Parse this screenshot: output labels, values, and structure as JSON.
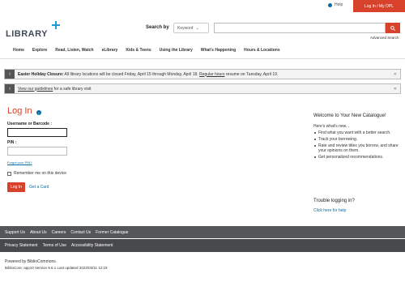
{
  "topbar": {
    "help_label": "Help",
    "login_label": "Log In / My OPL"
  },
  "logo": {
    "text": "LIBRARY"
  },
  "search": {
    "label": "Search by",
    "type_selected": "Keyword",
    "advanced_label": "Advanced Search"
  },
  "nav": {
    "items": [
      "Home",
      "Explore",
      "Read, Listen, Watch",
      "eLibrary",
      "Kids & Teens",
      "Using the Library",
      "What's Happening",
      "Hours & Locations"
    ]
  },
  "alerts": [
    {
      "bold": "Easter Holiday Closure:",
      "text": " All library locations will be closed Friday, April 15 through Monday, April 18. ",
      "link": "Regular hours",
      "text_after": " resume on Tuesday, April 19."
    },
    {
      "link": "View our guidelines",
      "text_after": " for a safe library visit"
    }
  ],
  "login": {
    "title": "Log In",
    "username_label": "Username or Barcode :",
    "pin_label": "PIN :",
    "forgot_label": "Forgot your PIN?",
    "remember_label": "Remember me on this device",
    "button_label": "Log In",
    "getcard_label": "Get a Card"
  },
  "aside": {
    "title": "Welcome to Your New Catalogue!",
    "intro": "Here's what's new...",
    "items": [
      "Find what you want with a better search.",
      "Track your borrowing.",
      "Rate and review titles you borrow, and share your opinions on them.",
      "Get personalized recommendations."
    ],
    "trouble_title": "Trouble logging in?",
    "help_link": "Click here for help"
  },
  "footer": {
    "links1": [
      "Support Us",
      "About Us",
      "Careers",
      "Contact Us",
      "Former Catalogue"
    ],
    "links2": [
      "Privacy Statement",
      "Terms of Use",
      "Accessibility Statement"
    ],
    "powered": "Powered by BiblioCommons.",
    "version": "BiblioCore: app10 Version 9.6.1 Last updated 2022/03/11 12:19"
  },
  "colors": {
    "accent": "#d8412a",
    "link": "#0b6aa2",
    "footer_dark": "#55565a"
  }
}
